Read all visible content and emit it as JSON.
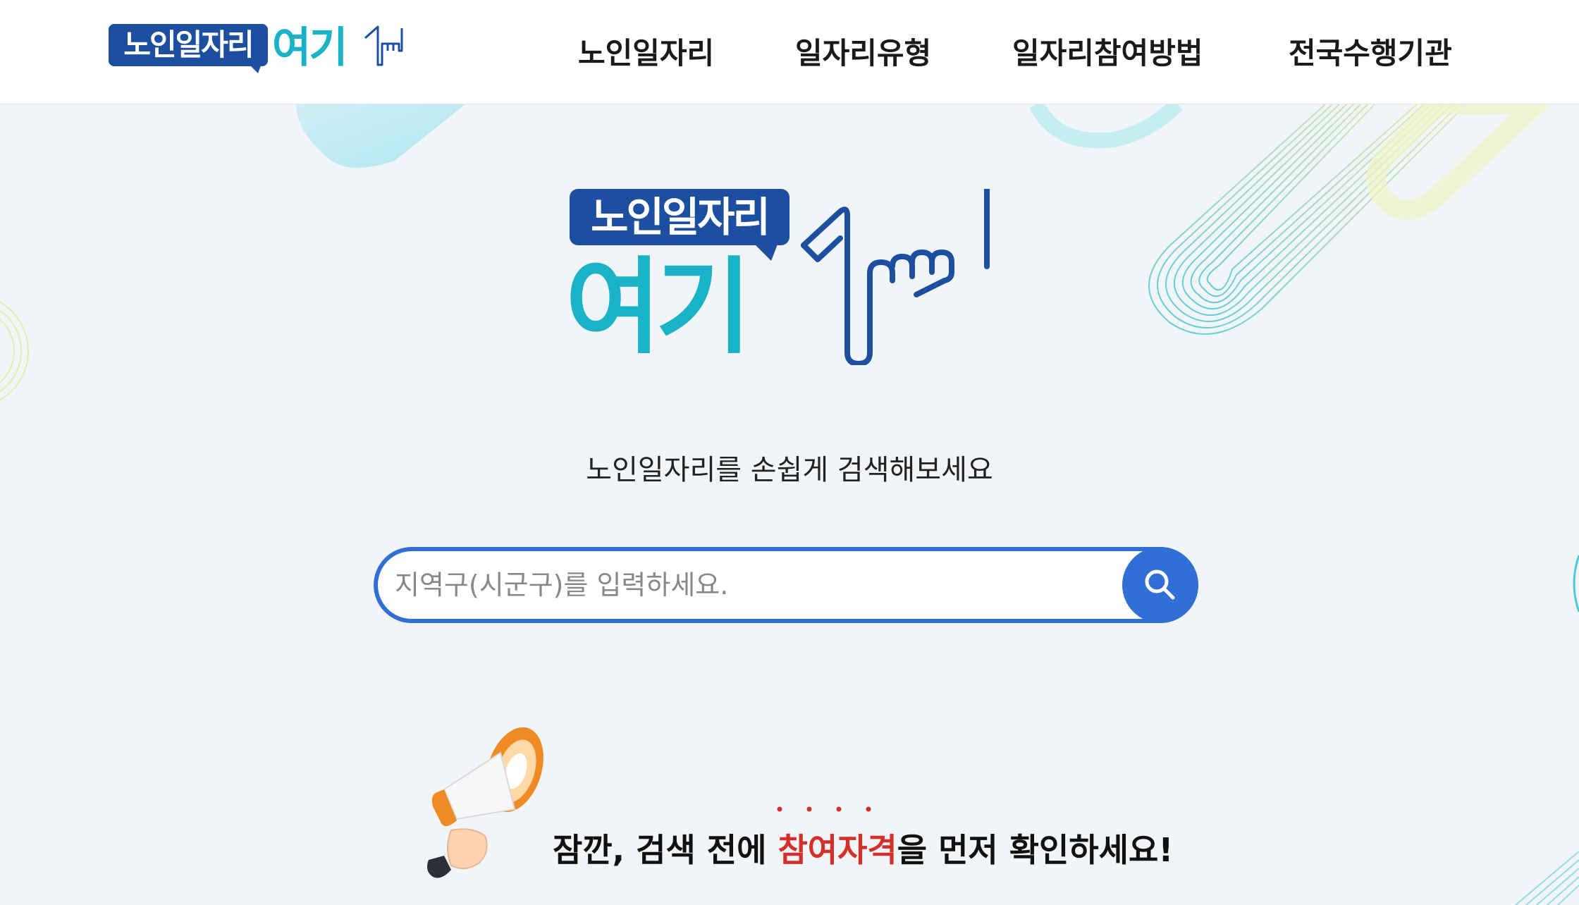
{
  "header": {
    "logo": {
      "badge_text": "노인일자리",
      "yeogi_text": "여기"
    },
    "nav": [
      {
        "label": "노인일자리"
      },
      {
        "label": "일자리유형"
      },
      {
        "label": "일자리참여방법"
      },
      {
        "label": "전국수행기관"
      }
    ]
  },
  "hero": {
    "logo": {
      "badge_text": "노인일자리",
      "yeogi_text": "여기"
    },
    "subtitle": "노인일자리를 손쉽게 검색해보세요"
  },
  "search": {
    "placeholder": "지역구(시군구)를 입력하세요.",
    "value": ""
  },
  "notice": {
    "prefix": "잠깐, 검색 전에 ",
    "highlight": "참여자격",
    "suffix": "을 먼저 확인하세요!"
  },
  "colors": {
    "brand_blue": "#1d4fa0",
    "brand_teal": "#1ab2c6",
    "search_blue": "#2f6fd6",
    "highlight_red": "#d4302a"
  }
}
